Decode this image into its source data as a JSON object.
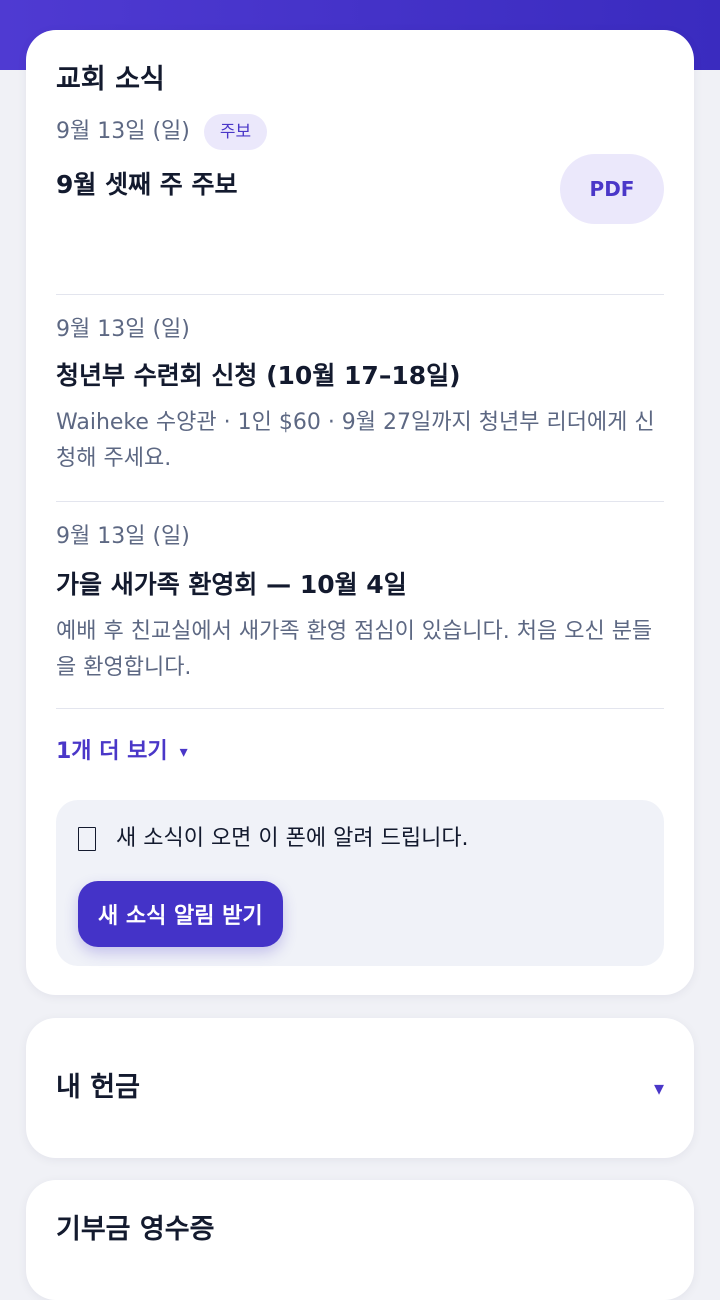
{
  "news": {
    "title": "교회 소식",
    "items": [
      {
        "date": "9월 13일 (일)",
        "badge": "주보",
        "title": "9월 셋째 주 주보",
        "action_label": "PDF"
      },
      {
        "date": "9월 13일 (일)",
        "title": "청년부 수련회 신청 (10월 17–18일)",
        "body": "Waiheke 수양관 · 1인 $60 · 9월 27일까지 청년부 리더에게 신청해 주세요."
      },
      {
        "date": "9월 13일 (일)",
        "title": "가을 새가족 환영회 — 10월 4일",
        "body": "예배 후 친교실에서 새가족 환영 점심이 있습니다. 처음 오신 분들을 환영합니다."
      }
    ],
    "more_label": "1개 더 보기",
    "more_icon": "▾",
    "notify": {
      "icon": "bell-icon",
      "text": "새 소식이 오면 이 폰에 알려 드립니다.",
      "button_label": "새 소식 알림 받기"
    }
  },
  "giving": {
    "title": "내 헌금",
    "toggle_icon": "▾"
  },
  "receipts": {
    "title": "기부금 영수증"
  },
  "colors": {
    "accent": "#4433c8",
    "accent_soft": "#ebe8fb",
    "header_band": "#4f3ad2",
    "text": "#131a2e",
    "muted": "#5d6883",
    "background": "#f0f1f6"
  }
}
